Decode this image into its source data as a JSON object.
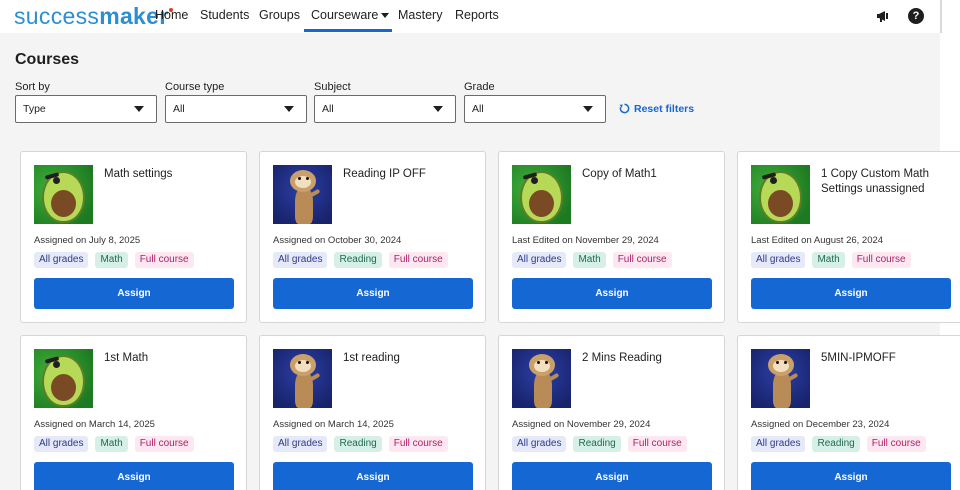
{
  "app": {
    "logo_light": "success",
    "logo_bold": "maker"
  },
  "nav": {
    "items": [
      {
        "label": "Home"
      },
      {
        "label": "Students"
      },
      {
        "label": "Groups"
      },
      {
        "label": "Courseware"
      },
      {
        "label": "Mastery"
      },
      {
        "label": "Reports"
      }
    ],
    "active": "Courseware",
    "icons": [
      "megaphone-icon",
      "help-icon"
    ],
    "help_glyph": "?"
  },
  "page": {
    "title": "Courses"
  },
  "filters": {
    "sort_by": {
      "label": "Sort by",
      "value": "Type"
    },
    "course_type": {
      "label": "Course type",
      "value": "All"
    },
    "subject": {
      "label": "Subject",
      "value": "All"
    },
    "grade": {
      "label": "Grade",
      "value": "All"
    },
    "reset_label": "Reset filters"
  },
  "colors": {
    "accent": "#1567d3",
    "background": "#f4f4f4",
    "logo": "#2b8fd1"
  },
  "assign_label": "Assign",
  "cards": [
    {
      "title": "Math settings",
      "date": "Assigned on July 8, 2025",
      "thumb": "avocado",
      "badges": [
        "All grades",
        "Math",
        "Full course"
      ]
    },
    {
      "title": "Reading IP OFF",
      "date": "Assigned on October 30, 2024",
      "thumb": "ferret",
      "badges": [
        "All grades",
        "Reading",
        "Full course"
      ]
    },
    {
      "title": "Copy of Math1",
      "date": "Last Edited on November 29, 2024",
      "thumb": "avocado",
      "badges": [
        "All grades",
        "Math",
        "Full course"
      ]
    },
    {
      "title": "1 Copy Custom Math Settings unassigned",
      "date": "Last Edited on August 26, 2024",
      "thumb": "avocado",
      "badges": [
        "All grades",
        "Math",
        "Full course"
      ]
    },
    {
      "title": "1st Math",
      "date": "Assigned on March 14, 2025",
      "thumb": "avocado",
      "badges": [
        "All grades",
        "Math",
        "Full course"
      ]
    },
    {
      "title": "1st reading",
      "date": "Assigned on March 14, 2025",
      "thumb": "ferret",
      "badges": [
        "All grades",
        "Reading",
        "Full course"
      ]
    },
    {
      "title": "2 Mins Reading",
      "date": "Assigned on November 29, 2024",
      "thumb": "ferret",
      "badges": [
        "All grades",
        "Reading",
        "Full course"
      ]
    },
    {
      "title": "5MIN-IPMOFF",
      "date": "Assigned on December 23, 2024",
      "thumb": "ferret",
      "badges": [
        "All grades",
        "Reading",
        "Full course"
      ]
    }
  ]
}
